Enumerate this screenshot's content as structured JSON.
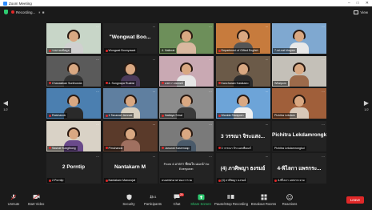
{
  "window": {
    "title": "Zoom Meeting"
  },
  "topbar": {
    "recording": "Recording...",
    "view": "View"
  },
  "paging": {
    "current": "1/2",
    "next_label": "1/2"
  },
  "participants": [
    {
      "name": "รวบรวมข้อมูล",
      "active": true,
      "muted": true,
      "type": "video",
      "bg": "#c8d6c8",
      "shirt": "#d0d0d0"
    },
    {
      "name": "\"Wongwat Boo...",
      "tag": "Wongwat Boonyawat",
      "muted": true,
      "type": "text"
    },
    {
      "name": "4. Nalinrat",
      "muted": false,
      "type": "video",
      "bg": "#6d8f5a",
      "shirt": "#d9b8a0"
    },
    {
      "name": "Department of Gifted English",
      "muted": true,
      "type": "video",
      "bg": "#c77b3d",
      "shirt": "#555"
    },
    {
      "name": "7-sri-nat khayan",
      "muted": false,
      "type": "video",
      "bg": "#7fa8d0",
      "shirt": "#e8e8e8"
    },
    {
      "name": "Chanasikan Sunthonda",
      "muted": true,
      "type": "video",
      "bg": "#5a5a5a",
      "shirt": "#333"
    },
    {
      "name": "4. Sungnapa Ruabsi",
      "muted": true,
      "type": "video",
      "bg": "#1f1f1f",
      "shirt": "#4a3a5a"
    },
    {
      "name": "แพรวา สมพงษ์",
      "muted": true,
      "type": "video",
      "bg": "#c9a9b3",
      "shirt": "#e6e6e6"
    },
    {
      "name": "Kanchanan Kasikaeo",
      "muted": true,
      "type": "video",
      "bg": "#6b5a48",
      "shirt": "#2c2c2c"
    },
    {
      "name": "Wilaiporn",
      "muted": false,
      "type": "video",
      "bg": "#c4c0b8",
      "shirt": "#9c6a4a"
    },
    {
      "name": "Ratchanok",
      "muted": true,
      "type": "video",
      "bg": "#4b7fb0",
      "shirt": "#2a2a2a"
    },
    {
      "name": "1.Tanawat Jamnak",
      "muted": true,
      "type": "video",
      "bg": "#5f7fa0",
      "shirt": "#d8d0c0"
    },
    {
      "name": "Nattaya Srirat",
      "muted": true,
      "type": "video",
      "bg": "#8c8c8c",
      "shirt": "#3a3a3a"
    },
    {
      "name": "Wanida Siwaporn",
      "muted": true,
      "type": "video",
      "bg": "#6da4d8",
      "shirt": "#f0f0f0"
    },
    {
      "name": "Pichitra Lekdam",
      "muted": false,
      "type": "video",
      "bg": "#a05f3a",
      "shirt": "#d8c8b8"
    },
    {
      "name": "Sasirat Sungthong",
      "muted": true,
      "type": "video",
      "bg": "#d9d2c6",
      "shirt": "#6a4a8a"
    },
    {
      "name": "Pimchanok",
      "muted": true,
      "type": "video",
      "bg": "#5a3a2a",
      "shirt": "#a07060"
    },
    {
      "name": "Jaruwat Kasemsap",
      "muted": true,
      "type": "video",
      "bg": "#7a7a7a",
      "shirt": "#4a5a6a"
    },
    {
      "name": "3 วรรณา จิระแสง...",
      "tag": "3 วรรณา จิระแสงพีเคอร์",
      "muted": true,
      "type": "text"
    },
    {
      "name": "Pichitra Lekdamrongkul",
      "tag": "Pichitra Lekdamrongkul",
      "muted": false,
      "type": "text"
    },
    {
      "name": "2 Porntip",
      "tag": "2.Porntip",
      "muted": true,
      "type": "text"
    },
    {
      "name": "Nantakarn M",
      "tag": "Nantakarn Manorojat",
      "muted": true,
      "type": "text"
    },
    {
      "name": "From 4 มาตรา ที่พอใจ.แนะนำ to Everyone:",
      "tag": "ธนนทพรมาศ ทองวารวม",
      "muted": false,
      "type": "chat"
    },
    {
      "name": "(4) ภาศิพญา ธงรมย์",
      "tag": "(4) ภาศิพญา ธงรมย์",
      "muted": true,
      "type": "text"
    },
    {
      "name": "4-พิไลกา แพรกระ...",
      "tag": "4-พิไลกา แพรกระจาย",
      "muted": true,
      "type": "text"
    }
  ],
  "toolbar": {
    "unmute": "Unmute",
    "start_video": "Start Video",
    "security": "Security",
    "participants": "Participants",
    "participants_count": "41",
    "chat": "Chat",
    "chat_badge": "25",
    "share_screen": "Share Screen",
    "pause_record": "Pause/Stop Recording",
    "breakout": "Breakout Rooms",
    "reactions": "Reactions",
    "leave": "Leave"
  },
  "colors": {
    "accent": "#2d8cff",
    "active_speaker": "#f2d230",
    "leave": "#e02828",
    "share": "#2ecc71"
  }
}
